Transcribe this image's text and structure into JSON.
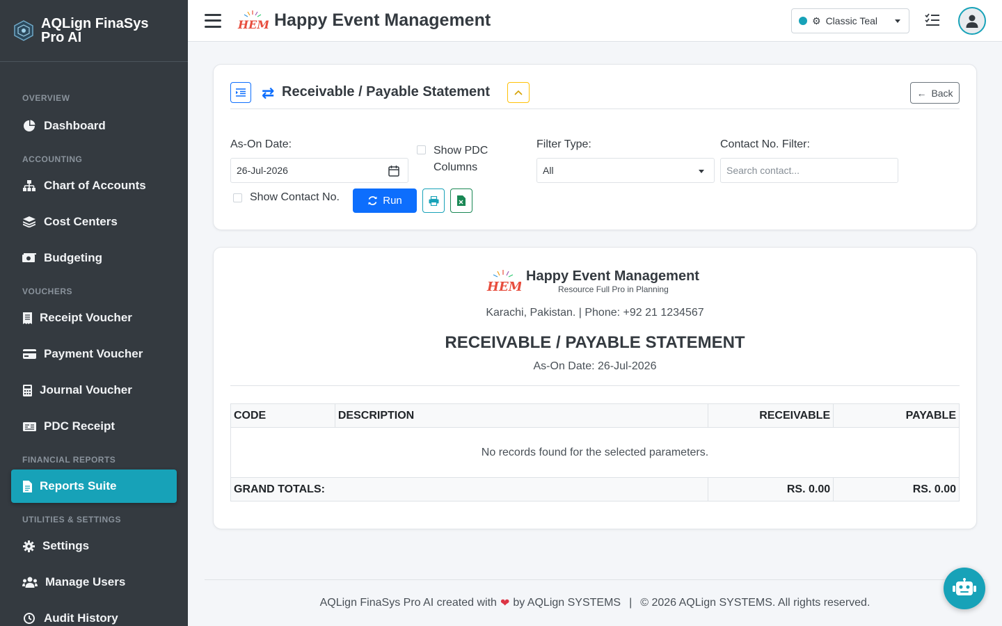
{
  "sidebar": {
    "brand": "AQLign FinaSys Pro AI",
    "sections": [
      {
        "title": "OVERVIEW",
        "items": [
          {
            "label": "Dashboard",
            "icon": "pie-chart-icon"
          }
        ]
      },
      {
        "title": "ACCOUNTING",
        "items": [
          {
            "label": "Chart of Accounts",
            "icon": "sitemap-icon"
          },
          {
            "label": "Cost Centers",
            "icon": "layers-icon"
          },
          {
            "label": "Budgeting",
            "icon": "money-icon"
          }
        ]
      },
      {
        "title": "VOUCHERS",
        "items": [
          {
            "label": "Receipt Voucher",
            "icon": "receipt-icon"
          },
          {
            "label": "Payment Voucher",
            "icon": "credit-card-icon"
          },
          {
            "label": "Journal Voucher",
            "icon": "calculator-icon"
          },
          {
            "label": "PDC Receipt",
            "icon": "cheque-icon"
          }
        ]
      },
      {
        "title": "FINANCIAL REPORTS",
        "items": [
          {
            "label": "Reports Suite",
            "icon": "file-report-icon",
            "active": true
          }
        ]
      },
      {
        "title": "UTILITIES & SETTINGS",
        "items": [
          {
            "label": "Settings",
            "icon": "gear-icon"
          },
          {
            "label": "Manage Users",
            "icon": "users-icon"
          },
          {
            "label": "Audit History",
            "icon": "history-icon"
          }
        ]
      }
    ]
  },
  "header": {
    "title": "Happy Event Management",
    "logo_text": "HEM",
    "theme": {
      "label": "Classic Teal",
      "color": "#17a2b8"
    }
  },
  "filter": {
    "title": "Receivable / Payable Statement",
    "back_label": "Back",
    "as_on_label": "As-On Date:",
    "as_on_value": "26-Jul-2026",
    "show_pdc_label_1": "Show PDC",
    "show_pdc_label_2": "Columns",
    "filter_type_label": "Filter Type:",
    "filter_type_value": "All",
    "contact_label": "Contact No. Filter:",
    "contact_placeholder": "Search contact...",
    "show_contact_label": "Show Contact No.",
    "run_label": "Run"
  },
  "report": {
    "company": "Happy Event Management",
    "tagline": "Resource Full Pro in Planning",
    "address": "Karachi, Pakistan. | Phone: +92 21 1234567",
    "title": "RECEIVABLE / PAYABLE STATEMENT",
    "date_line": "As-On Date: 26-Jul-2026",
    "columns": [
      "CODE",
      "DESCRIPTION",
      "RECEIVABLE",
      "PAYABLE"
    ],
    "empty_message": "No records found for the selected parameters.",
    "totals_label": "GRAND TOTALS:",
    "total_receivable": "RS. 0.00",
    "total_payable": "RS. 0.00"
  },
  "footer": {
    "part1": "AQLign FinaSys Pro AI created with",
    "part2": "by AQLign SYSTEMS",
    "separator": "|",
    "copyright": "© 2026 AQLign SYSTEMS. All rights reserved."
  }
}
